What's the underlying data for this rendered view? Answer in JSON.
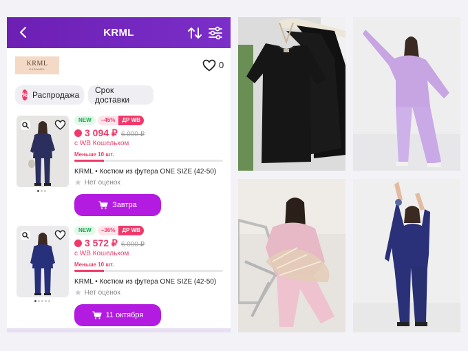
{
  "header": {
    "title": "KRML",
    "back_icon": "chevron-left-icon",
    "sort_icon": "sort-arrows-icon",
    "filter_icon": "filter-sliders-icon",
    "color": "#7129be"
  },
  "brand": {
    "logo_text": "KRML",
    "logo_subtext": "KARAMEL",
    "favorites_count": "0"
  },
  "chips": [
    {
      "label": "Распродажа",
      "icon": "%"
    },
    {
      "label": "Срок доставки"
    }
  ],
  "products": [
    {
      "badge_new": "NEW",
      "discount": "−45%",
      "wb_badge": "ДР WB",
      "price": "3 094 ₽",
      "old_price": "6 000 ₽",
      "wallet": "с WB Кошельком",
      "stock": "Меньше 10 шт.",
      "stock_fraction": 0.2,
      "title": "KRML • Костюм из футера ONE SIZE (42-50)",
      "rating": "Нет оценок",
      "cta": "Завтра",
      "image_dots": 3,
      "suit_color": "#2b2f5e"
    },
    {
      "badge_new": "NEW",
      "discount": "−36%",
      "wb_badge": "ДР WB",
      "price": "3 572 ₽",
      "old_price": "6 000 ₽",
      "wallet": "с WB Кошельком",
      "stock": "Меньше 10 шт.",
      "stock_fraction": 0.2,
      "title": "KRML • Костюм из футера ONE SIZE (42-50)",
      "rating": "Нет оценок",
      "cta": "11 октября",
      "image_dots": 5,
      "suit_color": "#27307a"
    }
  ],
  "accent": "#f0396a",
  "button_color": "#b41be0"
}
